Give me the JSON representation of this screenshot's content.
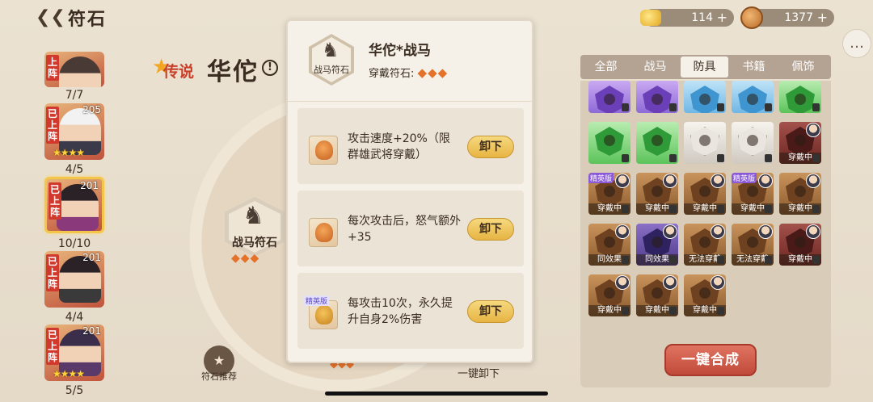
{
  "topbar": {
    "title": "符石",
    "gold": "114",
    "coins": "1377",
    "plus": "+"
  },
  "heroes": [
    {
      "deployed": "上阵",
      "level": "",
      "count": "7/7",
      "stars": ""
    },
    {
      "deployed": "已上阵",
      "level": "205",
      "count": "4/5",
      "stars": "★★★★"
    },
    {
      "deployed": "已上阵",
      "level": "201",
      "count": "10/10",
      "stars": ""
    },
    {
      "deployed": "已上阵",
      "level": "201",
      "count": "4/4",
      "stars": ""
    },
    {
      "deployed": "已上阵",
      "level": "201",
      "count": "5/5",
      "stars": "★★★★"
    }
  ],
  "hero": {
    "rarity": "传说",
    "name": "华佗",
    "info": "!"
  },
  "slot": {
    "label": "战马符石",
    "diamonds": "◆◆◆"
  },
  "bottom": {
    "recommend": "符石推荐",
    "unequip_all": "一键卸下"
  },
  "popup": {
    "title": "华佗*战马",
    "icon_label": "战马符石",
    "sub_label": "穿戴符石:",
    "diamonds": "◆◆◆",
    "effects": [
      {
        "desc": "攻击速度+20%（限群雄武将穿戴）",
        "button": "卸下",
        "tag": ""
      },
      {
        "desc": "每次攻击后，怒气额外+35",
        "button": "卸下",
        "tag": ""
      },
      {
        "desc": "每攻击10次，永久提升自身2%伤害",
        "button": "卸下",
        "tag": "精英版"
      }
    ]
  },
  "tabs": [
    "全部",
    "战马",
    "防具",
    "书籍",
    "佩饰"
  ],
  "active_tab": "防具",
  "runes": [
    {
      "color": "purple",
      "status": ""
    },
    {
      "color": "purple",
      "status": ""
    },
    {
      "color": "blue",
      "status": ""
    },
    {
      "color": "blue",
      "status": ""
    },
    {
      "color": "green",
      "status": ""
    },
    {
      "color": "green",
      "status": ""
    },
    {
      "color": "green",
      "status": ""
    },
    {
      "color": "white",
      "status": ""
    },
    {
      "color": "white",
      "status": ""
    },
    {
      "color": "red",
      "status": "穿戴中"
    },
    {
      "color": "orange",
      "status": "穿戴中",
      "tag": "精英版"
    },
    {
      "color": "orange",
      "status": "穿戴中"
    },
    {
      "color": "orange",
      "status": "穿戴中"
    },
    {
      "color": "orange",
      "status": "穿戴中",
      "tag": "精英版"
    },
    {
      "color": "orange",
      "status": "穿戴中"
    },
    {
      "color": "orange",
      "status": "同效果"
    },
    {
      "color": "violet",
      "status": "同效果"
    },
    {
      "color": "orange",
      "status": "无法穿戴"
    },
    {
      "color": "orange",
      "status": "无法穿戴"
    },
    {
      "color": "red",
      "status": "穿戴中"
    },
    {
      "color": "orange",
      "status": "穿戴中"
    },
    {
      "color": "orange",
      "status": "穿戴中"
    },
    {
      "color": "orange",
      "status": "穿戴中"
    }
  ],
  "merge_button": "一键合成"
}
